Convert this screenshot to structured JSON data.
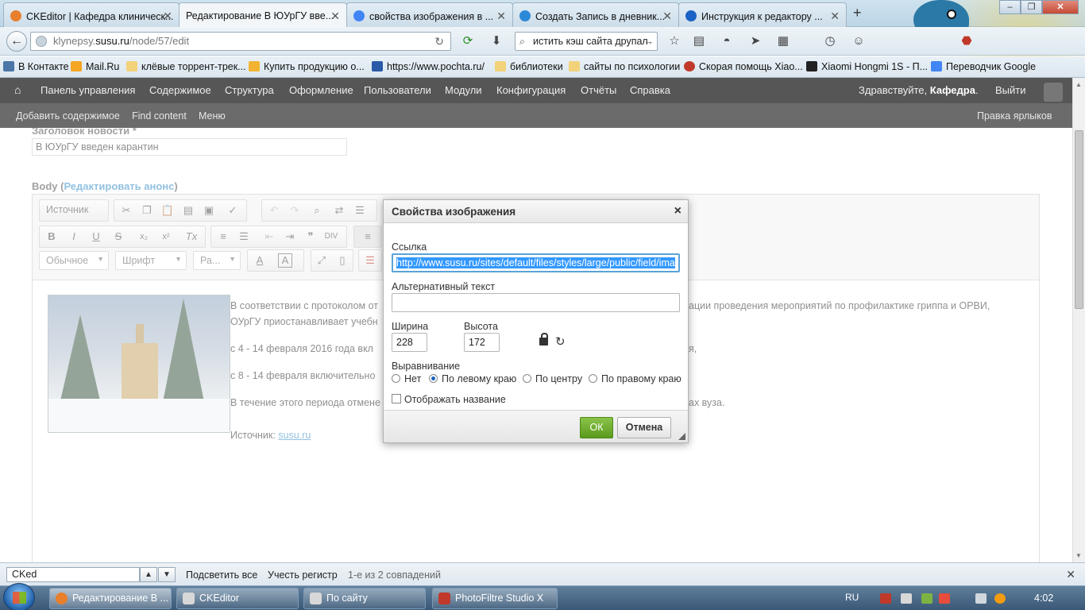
{
  "browser": {
    "tabs": [
      {
        "label": "CKEditor | Кафедра клиническ...",
        "icon_color": "#e87f2c"
      },
      {
        "label": "Редактирование В ЮУрГУ вве...",
        "icon_color": "#e87f2c"
      },
      {
        "label": "свойства изображения в ...",
        "icon_color": "#4285f4"
      },
      {
        "label": "Создать Запись в дневник...",
        "icon_color": "#2b89d8"
      },
      {
        "label": "Инструкция к редактору ...",
        "icon_color": "#1a62c5"
      }
    ],
    "new_tab": "+",
    "url_prefix": "klynepsy.",
    "url_host": "susu.ru",
    "url_path": "/node/57/edit",
    "search_value": "истить кэш сайта друпал",
    "window_buttons": [
      "–",
      "❐",
      "✕"
    ]
  },
  "bookmarks": [
    {
      "label": "В Контакте",
      "icon_color": "#4a76a8"
    },
    {
      "label": "Mail.Ru",
      "icon_color": "#f5a623"
    },
    {
      "label": "клёвые торрент-трек...",
      "icon_color": "#f2d27a"
    },
    {
      "label": "Купить продукцию о...",
      "icon_color": "#f2b430"
    },
    {
      "label": "https://www.pochta.ru/",
      "icon_color": "#2a5aa8"
    },
    {
      "label": "библиотеки",
      "icon_color": "#f2d27a"
    },
    {
      "label": "сайты по психологии",
      "icon_color": "#f2d27a"
    },
    {
      "label": "Скорая помощь Xiao...",
      "icon_color": "#c0392b"
    },
    {
      "label": "Xiaomi Hongmi 1S - П...",
      "icon_color": "#222222"
    },
    {
      "label": "Переводчик Google",
      "icon_color": "#4285f4"
    }
  ],
  "admin_toolbar": {
    "items": [
      "Панель управления",
      "Содержимое",
      "Структура",
      "Оформление",
      "Пользователи",
      "Модули",
      "Конфигурация",
      "Отчёты",
      "Справка"
    ],
    "greeting": "Здравствуйте, ",
    "username": "Кафедра",
    "greeting_end": ".",
    "logout": "Выйти"
  },
  "shortcuts": {
    "items": [
      "Добавить содержимое",
      "Find content",
      "Меню"
    ],
    "edit_shortcuts": "Правка ярлыков"
  },
  "form": {
    "title_label": "Заголовок новости *",
    "title_value": "В ЮУрГУ введен карантин",
    "body_label": "Body (",
    "body_link": "Редактировать анонс",
    "body_label_end": ")"
  },
  "editor": {
    "source_button": "Источник",
    "format_combo": "Обычное",
    "font_combo": "Шрифт",
    "size_combo": "Ра...",
    "content_lines": [
      "В соответствии с протоколом от",
      "ации проведения мероприятий по профилактике гриппа и ОРВИ,",
      "ОУрГУ приостанавливает учебн",
      "с 4 - 14 февраля 2016 года вкл",
      "я,",
      "с 8 - 14 февраля включительно",
      "В течение этого периода отмене",
      "ах вуза."
    ],
    "source_label": "Источник: ",
    "source_link": "susu.ru"
  },
  "image_dialog": {
    "title": "Свойства изображения",
    "close": "×",
    "url_label": "Ссылка",
    "url_value": "http://www.susu.ru/sites/default/files/styles/large/public/field/ima",
    "alt_label": "Альтернативный текст",
    "alt_value": "",
    "width_label": "Ширина",
    "width_value": "228",
    "height_label": "Высота",
    "height_value": "172",
    "align_label": "Выравнивание",
    "align_options": [
      "Нет",
      "По левому краю",
      "По центру",
      "По правому краю"
    ],
    "align_selected": "По левому краю",
    "caption_label": "Отображать название",
    "caption_checked": false,
    "ok": "ОК",
    "cancel": "Отмена"
  },
  "find_bar": {
    "query": "CKed",
    "highlight_all": "Подсветить все",
    "match_case": "Учесть регистр",
    "status": "1-е из 2 совпадений"
  },
  "taskbar": {
    "tasks": [
      {
        "label": "Редактирование В ...",
        "icon_color": "#e87f2c"
      },
      {
        "label": "CKEditor",
        "icon_color": "#d8d8d8"
      },
      {
        "label": "По сайту",
        "icon_color": "#d8d8d8"
      },
      {
        "label": "PhotoFiltre Studio X",
        "icon_color": "#c0392b"
      }
    ],
    "language": "RU",
    "time": "4:02"
  }
}
